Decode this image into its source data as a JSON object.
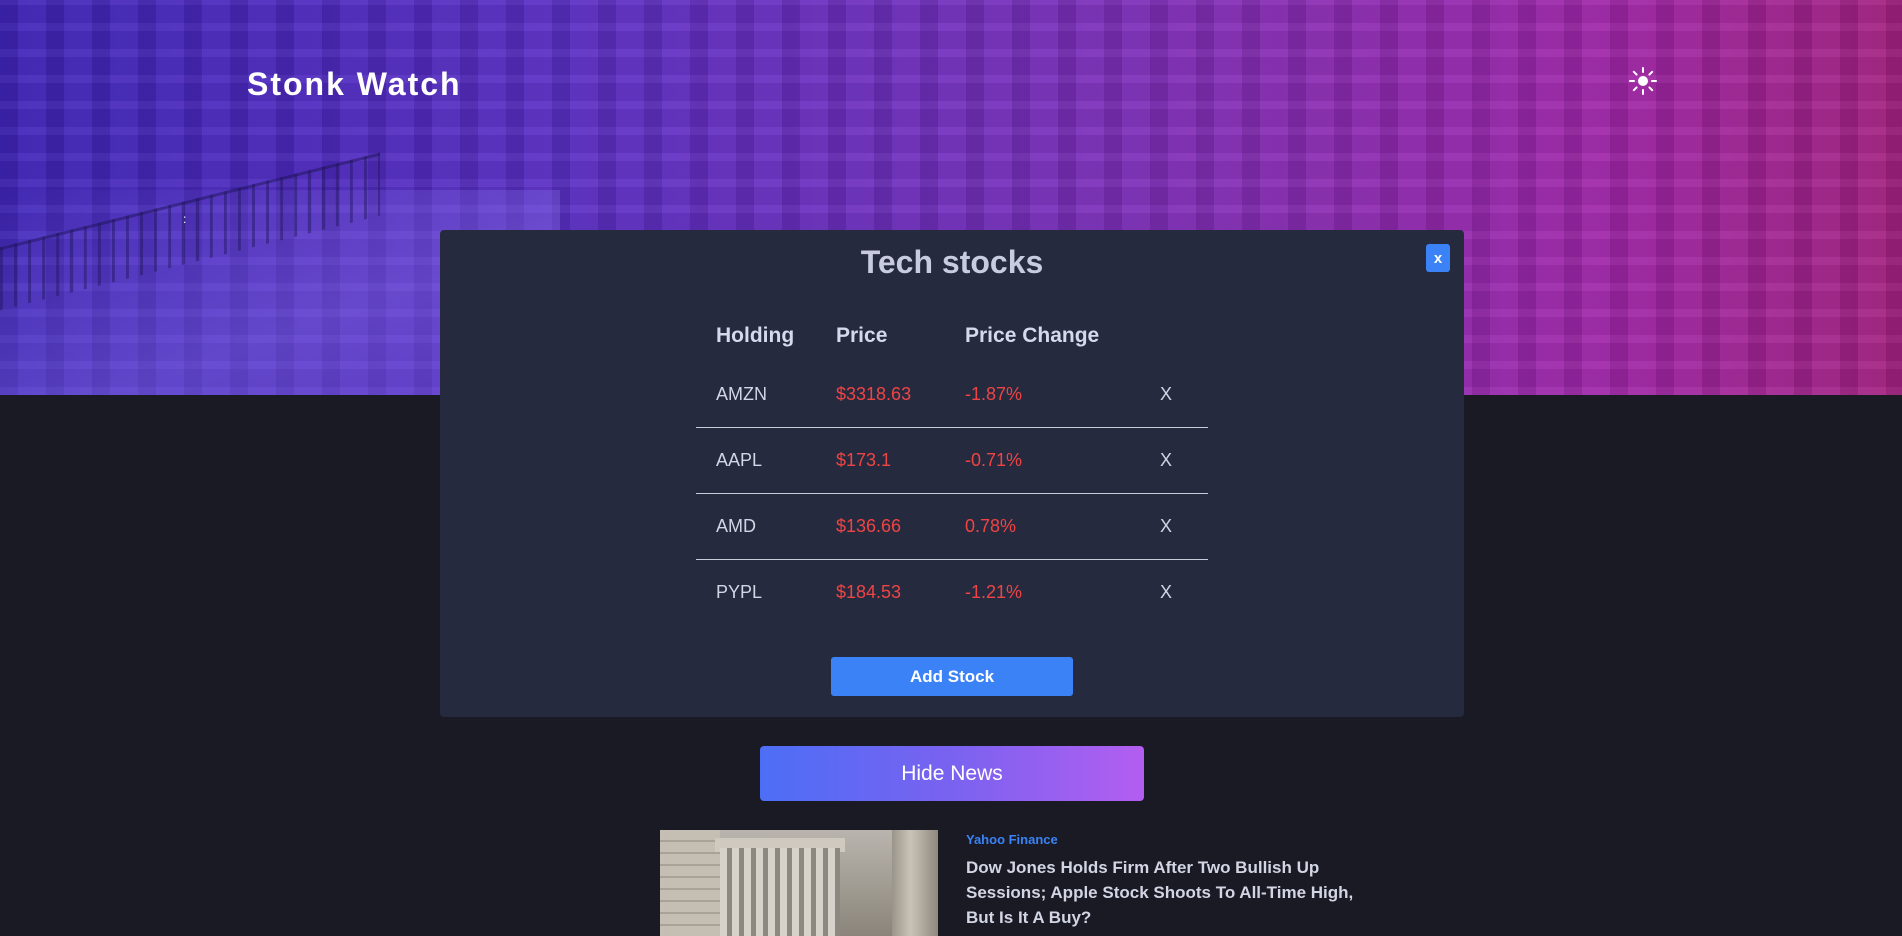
{
  "header": {
    "brand": "Stonk Watch",
    "theme_icon": "sun-icon"
  },
  "watchlist": {
    "title": "Tech stocks",
    "close_label": "x",
    "columns": [
      "Holding",
      "Price",
      "Price Change"
    ],
    "rows": [
      {
        "symbol": "AMZN",
        "price": "$3318.63",
        "change": "-1.87%",
        "remove": "X"
      },
      {
        "symbol": "AAPL",
        "price": "$173.1",
        "change": "-0.71%",
        "remove": "X"
      },
      {
        "symbol": "AMD",
        "price": "$136.66",
        "change": "0.78%",
        "remove": "X"
      },
      {
        "symbol": "PYPL",
        "price": "$184.53",
        "change": "-1.21%",
        "remove": "X"
      }
    ],
    "add_label": "Add Stock"
  },
  "news": {
    "toggle_label": "Hide News",
    "items": [
      {
        "source": "Yahoo Finance",
        "headline": "Dow Jones Holds Firm After Two Bullish Up Sessions; Apple Stock Shoots To All-Time High, But Is It A Buy?"
      }
    ]
  },
  "colors": {
    "accent": "#3b82f6",
    "negative": "#ef4444",
    "panel": "#262a3f",
    "background": "#191a24"
  }
}
